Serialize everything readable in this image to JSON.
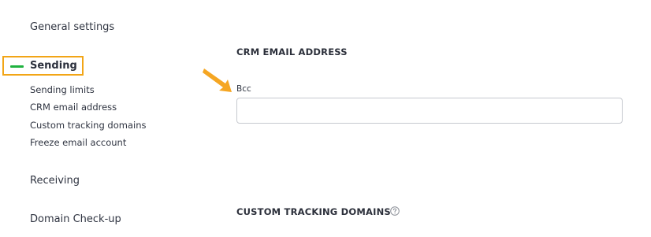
{
  "sidebar": {
    "general_settings": "General settings",
    "sending": "Sending",
    "sending_sub": [
      "Sending limits",
      "CRM email address",
      "Custom tracking domains",
      "Freeze email account"
    ],
    "receiving": "Receiving",
    "domain_checkup": "Domain Check-up"
  },
  "main": {
    "crm_section_title": "CRM EMAIL ADDRESS",
    "bcc_label": "Bcc",
    "bcc_value": "",
    "tracking_section_title": "CUSTOM TRACKING DOMAINS"
  },
  "colors": {
    "highlight_border": "#f2a516",
    "active_marker": "#1fb23f",
    "arrow": "#f5a623"
  },
  "icons": {
    "help": "question-circle-icon",
    "pointer": "arrow-pointer-icon"
  }
}
